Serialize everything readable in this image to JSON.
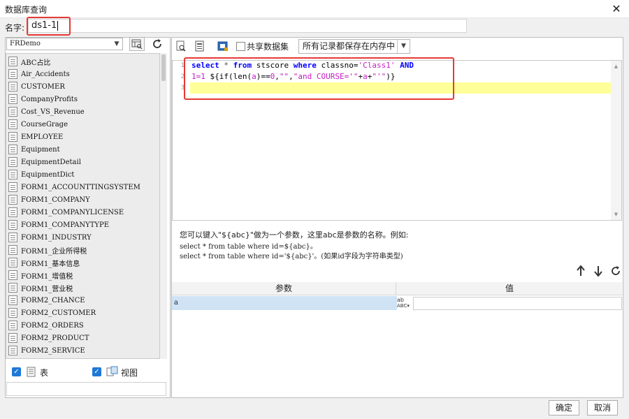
{
  "window": {
    "title": "数据库查询",
    "close_symbol": "✕"
  },
  "name_field": {
    "label": "名字:",
    "value": "ds1-1"
  },
  "left": {
    "db_select_value": "FRDemo",
    "tables": [
      "ABC占比",
      "Air_Accidents",
      "CUSTOMER",
      "CompanyProfits",
      "Cost_VS_Revenue",
      "CourseGrage",
      "EMPLOYEE",
      "Equipment",
      "EquipmentDetail",
      "EquipmentDict",
      "FORM1_ACCOUNTTINGSYSTEM",
      "FORM1_COMPANY",
      "FORM1_COMPANYLICENSE",
      "FORM1_COMPANYTYPE",
      "FORM1_INDUSTRY",
      "FORM1_企业所得税",
      "FORM1_基本信息",
      "FORM1_增值税",
      "FORM1_营业税",
      "FORM2_CHANCE",
      "FORM2_CUSTOMER",
      "FORM2_ORDERS",
      "FORM2_PRODUCT",
      "FORM2_SERVICE"
    ],
    "check_table_label": "表",
    "check_view_label": "视图"
  },
  "toolbar": {
    "shared_dataset_label": "共享数据集",
    "save_mode": "所有记录都保存在内存中"
  },
  "editor": {
    "line_numbers": [
      "1",
      "2",
      "3"
    ],
    "line1": {
      "k1": "select",
      "p1": " * ",
      "k2": "from",
      "p2": " stscore ",
      "k3": "where",
      "p3": " classno=",
      "s1": "'Class1'",
      "p4": " ",
      "k4": "AND"
    },
    "line2": {
      "a": "1=1",
      "b": " ${",
      "c": "if",
      "d": "(",
      "e": "len",
      "f": "(",
      "g": "a",
      "h": ")==",
      "i": "0",
      "j": ",",
      "k": "\"\"",
      "l": ",",
      "m": "\"and COURSE='\"",
      "n": "+",
      "o": "a",
      "p": "+",
      "q": "\"'\"",
      "r": ")}"
    }
  },
  "hints": {
    "line1": "您可以键入\"${abc}\"做为一个参数，这里abc是参数的名称。例如:",
    "line2": "select * from table where id=${abc}。",
    "line3": "select * from table where id='${abc}'。(如果id字段为字符串类型)"
  },
  "params": {
    "col_param": "参数",
    "col_value": "值",
    "rows": [
      {
        "name": "a",
        "value": ""
      }
    ],
    "type_label": "ABC"
  },
  "buttons": {
    "ok": "确定",
    "cancel": "取消"
  }
}
